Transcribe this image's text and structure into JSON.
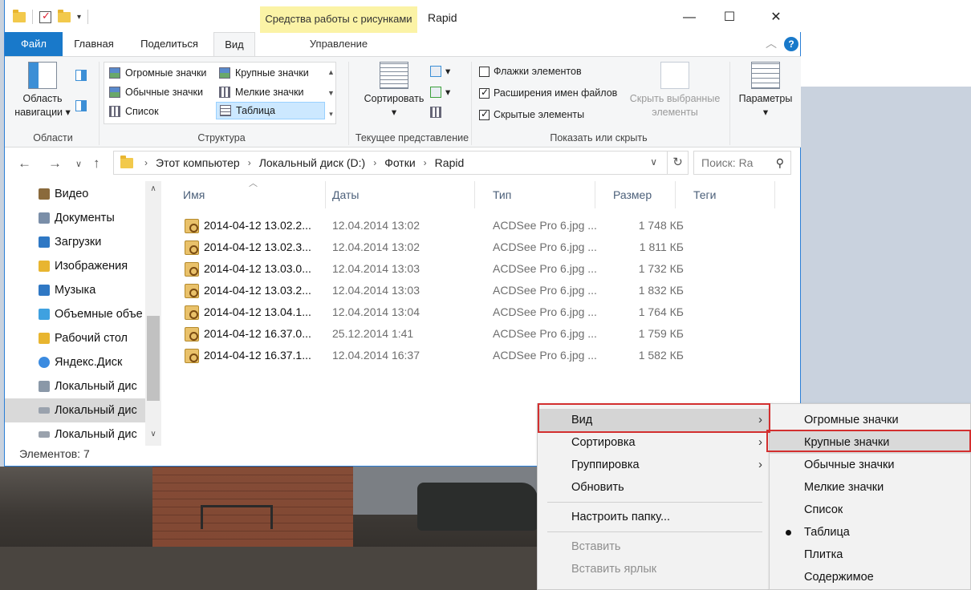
{
  "window": {
    "title": "Rapid",
    "contextual_group": "Средства работы с рисунками",
    "contextual_tab": "Управление",
    "controls": {
      "minimize": "—",
      "maximize": "☐",
      "close": "✕"
    }
  },
  "tabs": {
    "file": "Файл",
    "home": "Главная",
    "share": "Поделиться",
    "view": "Вид",
    "help": "?"
  },
  "ribbon": {
    "panes": {
      "nav_pane_label": "Область навигации",
      "nav_pane_line1": "Область",
      "nav_pane_line2": "навигации",
      "group": "Области"
    },
    "layout": {
      "items": [
        "Огромные значки",
        "Крупные значки",
        "Обычные значки",
        "Мелкие значки",
        "Список",
        "Таблица"
      ],
      "selected": "Таблица",
      "group": "Структура"
    },
    "current_view": {
      "sort_label": "Сортировать",
      "group": "Текущее представление"
    },
    "show_hide": {
      "checkbox_item": "Флажки элементов",
      "checkbox_item_checked": false,
      "extensions": "Расширения имен файлов",
      "extensions_checked": true,
      "hidden": "Скрытые элементы",
      "hidden_checked": true,
      "hide_selected_line1": "Скрыть выбранные",
      "hide_selected_line2": "элементы",
      "group": "Показать или скрыть"
    },
    "options": {
      "label": "Параметры"
    }
  },
  "address": {
    "crumbs": [
      "Этот компьютер",
      "Локальный диск (D:)",
      "Фотки",
      "Rapid"
    ],
    "search_placeholder": "Поиск: Ra"
  },
  "navpane": {
    "items": [
      {
        "label": "Видео",
        "icon": "video-folder-icon",
        "color": "#8a6a3c"
      },
      {
        "label": "Документы",
        "icon": "documents-folder-icon",
        "color": "#7a8ea8"
      },
      {
        "label": "Загрузки",
        "icon": "downloads-folder-icon",
        "color": "#2f78c4"
      },
      {
        "label": "Изображения",
        "icon": "pictures-folder-icon",
        "color": "#e8b530"
      },
      {
        "label": "Музыка",
        "icon": "music-folder-icon",
        "color": "#2f78c4"
      },
      {
        "label": "Объемные объе",
        "icon": "3d-objects-icon",
        "color": "#3fa1e0"
      },
      {
        "label": "Рабочий стол",
        "icon": "desktop-folder-icon",
        "color": "#e8b530"
      },
      {
        "label": "Яндекс.Диск",
        "icon": "yandex-disk-icon",
        "color": "#3b8be0"
      },
      {
        "label": "Локальный дис",
        "icon": "windows-drive-icon",
        "color": "#8a98a8"
      },
      {
        "label": "Локальный дис",
        "icon": "drive-icon",
        "color": "#9aa2ad"
      },
      {
        "label": "Локальный дис",
        "icon": "drive-icon",
        "color": "#9aa2ad"
      }
    ],
    "selected_index": 9
  },
  "columns": [
    "Имя",
    "Даты",
    "Тип",
    "Размер",
    "Теги"
  ],
  "files": [
    {
      "name": "2014-04-12 13.02.2...",
      "date": "12.04.2014 13:02",
      "type": "ACDSee Pro 6.jpg ...",
      "size": "1 748 КБ"
    },
    {
      "name": "2014-04-12 13.02.3...",
      "date": "12.04.2014 13:02",
      "type": "ACDSee Pro 6.jpg ...",
      "size": "1 811 КБ"
    },
    {
      "name": "2014-04-12 13.03.0...",
      "date": "12.04.2014 13:03",
      "type": "ACDSee Pro 6.jpg ...",
      "size": "1 732 КБ"
    },
    {
      "name": "2014-04-12 13.03.2...",
      "date": "12.04.2014 13:03",
      "type": "ACDSee Pro 6.jpg ...",
      "size": "1 832 КБ"
    },
    {
      "name": "2014-04-12 13.04.1...",
      "date": "12.04.2014 13:04",
      "type": "ACDSee Pro 6.jpg ...",
      "size": "1 764 КБ"
    },
    {
      "name": "2014-04-12 16.37.0...",
      "date": "25.12.2014 1:41",
      "type": "ACDSee Pro 6.jpg ...",
      "size": "1 759 КБ"
    },
    {
      "name": "2014-04-12 16.37.1...",
      "date": "12.04.2014 16:37",
      "type": "ACDSee Pro 6.jpg ...",
      "size": "1 582 КБ"
    }
  ],
  "status": {
    "count": "Элементов: 7"
  },
  "context_menu": {
    "items": [
      {
        "label": "Вид",
        "submenu": true,
        "highlighted": true
      },
      {
        "label": "Сортировка",
        "submenu": true
      },
      {
        "label": "Группировка",
        "submenu": true
      },
      {
        "label": "Обновить"
      },
      {
        "label": "Настроить папку..."
      },
      {
        "label": "Вставить",
        "disabled": true
      },
      {
        "label": "Вставить ярлык",
        "disabled": true
      }
    ]
  },
  "view_submenu": {
    "items": [
      "Огромные значки",
      "Крупные значки",
      "Обычные значки",
      "Мелкие значки",
      "Список",
      "Таблица",
      "Плитка",
      "Содержимое"
    ],
    "highlighted": "Крупные значки",
    "checked": "Таблица"
  },
  "colors": {
    "accent": "#1979ca",
    "annotation": "#d32f2f",
    "contextual": "#fbf3a6"
  }
}
